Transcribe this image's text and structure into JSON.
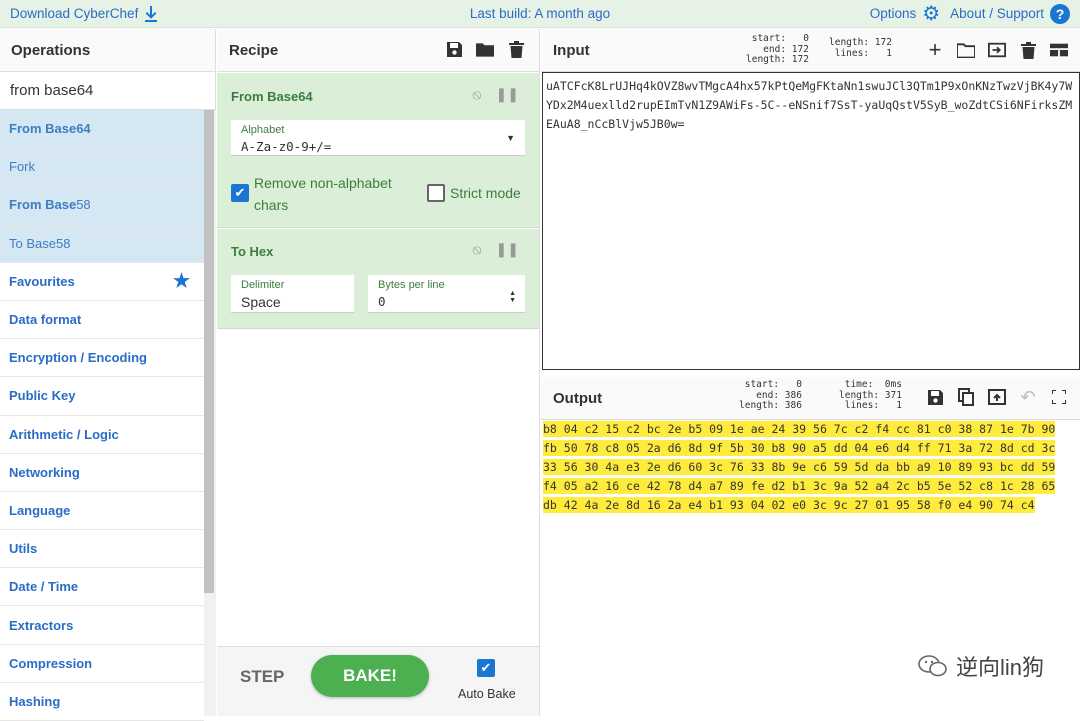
{
  "banner": {
    "download": "Download CyberChef",
    "last_build": "Last build: A month ago",
    "options": "Options",
    "about": "About / Support"
  },
  "operations": {
    "title": "Operations",
    "search_value": "from base64",
    "results": [
      {
        "bold": "From Base64",
        "rest": ""
      },
      {
        "bold": "",
        "rest": "Fork"
      },
      {
        "bold": "From Base",
        "rest": "58"
      },
      {
        "bold": "",
        "rest": "To Base58"
      }
    ],
    "categories": [
      "Favourites",
      "Data format",
      "Encryption / Encoding",
      "Public Key",
      "Arithmetic / Logic",
      "Networking",
      "Language",
      "Utils",
      "Date / Time",
      "Extractors",
      "Compression",
      "Hashing"
    ]
  },
  "recipe": {
    "title": "Recipe",
    "op1": {
      "title": "From Base64",
      "alphabet_label": "Alphabet",
      "alphabet_value": "A-Za-z0-9+/=",
      "remove_label_1": "Remove non-alphabet",
      "remove_label_2": "chars",
      "strict_label": "Strict mode"
    },
    "op2": {
      "title": "To Hex",
      "delimiter_label": "Delimiter",
      "delimiter_value": "Space",
      "bytes_label": "Bytes per line",
      "bytes_value": "0"
    },
    "step": "STEP",
    "bake": "BAKE!",
    "auto_bake": "Auto Bake"
  },
  "input": {
    "title": "Input",
    "stats_left": "start:   0\n  end: 172\nlength: 172",
    "stats_right": "length: 172\n lines:   1",
    "text": "uATCFcK8LrUJHq4kOVZ8wvTMgcA4hx57kPtQeMgFKtaNn1swuJCl3QTm1P9xOnKNzTwzVjBK4y7WYDx2M4uexlld2rupEImTvN1Z9AWiFs-5C--eNSnif7SsT-yaUqQstV5SyB_woZdtCSi6NFirksZMEAuA8_nCcBlVjw5JB0w="
  },
  "output": {
    "title": "Output",
    "stats_left": "start:   0\n  end: 386\nlength: 386",
    "stats_right": "time:  0ms\nlength: 371\n lines:   1",
    "lines": [
      "b8 04 c2 15 c2 bc 2e b5 09 1e ae 24 39 56 7c c2 f4 cc 81 c0 38 87 1e 7b 90",
      "fb 50 78 c8 05 2a d6 8d 9f 5b 30 b8 90 a5 dd 04 e6 d4 ff 71 3a 72 8d cd 3c",
      "33 56 30 4a e3 2e d6 60 3c 76 33 8b 9e c6 59 5d da bb a9 10 89 93 bc dd 59",
      "f4 05 a2 16 ce 42 78 d4 a7 89 fe d2 b1 3c 9a 52 a4 2c b5 5e 52 c8 1c 28 65",
      "db 42 4a 2e 8d 16 2a e4 b1 93 04 02 e0 3c 9c 27 01 95 58 f0 e4 90 74 c4"
    ]
  },
  "watermark": "逆向lin狗",
  "colors": {
    "accent": "#1976d2",
    "bake": "#4caf50",
    "op_card": "#dbefd8",
    "highlight": "#ffeb3b",
    "search_hl": "#d4e7f2"
  }
}
